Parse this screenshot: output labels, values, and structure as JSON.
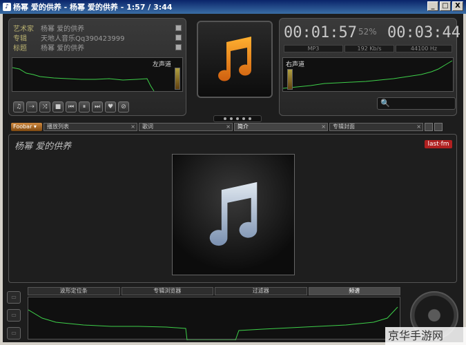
{
  "window": {
    "title": "杨幂 爱的供养 - 杨幂 爱的供养 - 1:57 / 3:44",
    "minimize": "_",
    "maximize": "□",
    "close": "X"
  },
  "meta": {
    "artist_label": "艺术家",
    "artist_value": "杨幂 爱的供养",
    "album_label": "专辑",
    "album_value": "天地人音乐Qq390423999",
    "title_label": "标题",
    "title_value": "杨幂 爱的供养"
  },
  "channels": {
    "left": "左声道",
    "right": "右声道"
  },
  "controls": [
    {
      "name": "music-note-button",
      "glyph": "♫"
    },
    {
      "name": "repeat-button",
      "glyph": "⇢"
    },
    {
      "name": "shuffle-button",
      "glyph": "⤨"
    },
    {
      "name": "stop-button",
      "glyph": "■"
    },
    {
      "name": "prev-button",
      "glyph": "⏮"
    },
    {
      "name": "pause-button",
      "glyph": "⏸"
    },
    {
      "name": "next-button",
      "glyph": "⏭"
    },
    {
      "name": "favorite-button",
      "glyph": "♥"
    },
    {
      "name": "block-button",
      "glyph": "⊘"
    }
  ],
  "playback": {
    "elapsed": "00:01:57",
    "percent": "52%",
    "total": "00:03:44",
    "format": "MP3",
    "bitrate": "192 Kb/s",
    "samplerate": "44100 Hz",
    "progress": 0.52
  },
  "search": {
    "icon": "search-icon",
    "glyph": "🔍"
  },
  "tabs": {
    "foobar_label": "Foobar ▾",
    "items": [
      {
        "label": "播放列表"
      },
      {
        "label": "歌词"
      },
      {
        "label": "简介"
      },
      {
        "label": "专辑封面"
      }
    ]
  },
  "main": {
    "song_title": "杨幂 爱的供养",
    "lastfm": "last·fm"
  },
  "bottom_tabs": [
    {
      "label": "波形定位条"
    },
    {
      "label": "专辑浏览器"
    },
    {
      "label": "过滤器"
    },
    {
      "label": "频谱"
    }
  ],
  "watermark": "京华手游网",
  "colors": {
    "accent": "#e8a020",
    "wave": "#3ed04a"
  }
}
